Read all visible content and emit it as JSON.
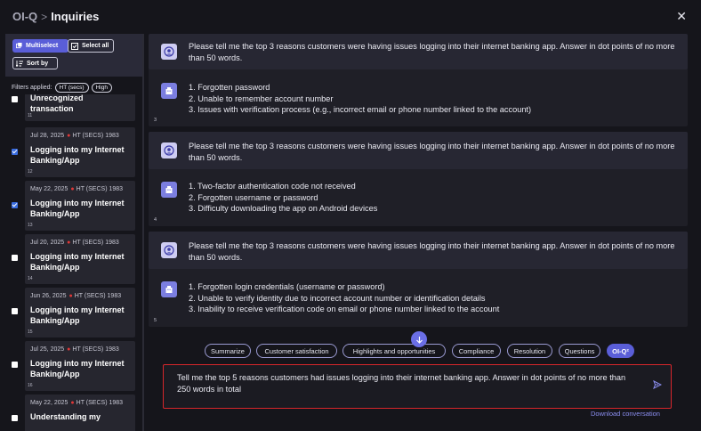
{
  "header": {
    "root": "OI-Q",
    "separator": ">",
    "current": "Inquiries",
    "close_glyph": "✕"
  },
  "left_toolbar": {
    "multiselect_label": "Multiselect",
    "select_all_label": "Select all",
    "sort_by_label": "Sort by",
    "filters_label": "Filters applied:",
    "filter_chips": [
      "HT (secs)",
      "High"
    ]
  },
  "inquiries": [
    {
      "date": "",
      "badge": "",
      "title": "Unrecognized transaction",
      "number": "11",
      "checked": false
    },
    {
      "date": "Jul 28, 2025",
      "badge": "HT (SECS) 1983",
      "title": "Logging into my Internet Banking/App",
      "number": "12",
      "checked": true
    },
    {
      "date": "May 22, 2025",
      "badge": "HT (SECS) 1983",
      "title": "Logging into my Internet Banking/App",
      "number": "13",
      "checked": true
    },
    {
      "date": "Jul 20, 2025",
      "badge": "HT (SECS) 1983",
      "title": "Logging into my Internet Banking/App",
      "number": "14",
      "checked": false
    },
    {
      "date": "Jun 26, 2025",
      "badge": "HT (SECS) 1983",
      "title": "Logging into my Internet Banking/App",
      "number": "15",
      "checked": false
    },
    {
      "date": "Jul 25, 2025",
      "badge": "HT (SECS) 1983",
      "title": "Logging into my Internet Banking/App",
      "number": "16",
      "checked": false
    },
    {
      "date": "May 22, 2025",
      "badge": "HT (SECS) 1983",
      "title": "Understanding my",
      "number": "",
      "checked": false
    }
  ],
  "conversation": [
    {
      "question": "Please tell me the top 3 reasons customers were having issues logging into their internet banking app. Answer in dot points of no more than 50 words.",
      "answer": [
        "1. Forgotten password",
        "2. Unable to remember account number",
        "3. Issues with verification process (e.g., incorrect email or phone number linked to the account)"
      ],
      "number": "3"
    },
    {
      "question": "Please tell me the top 3 reasons customers were having issues logging into their internet banking app. Answer in dot points of no more than 50 words.",
      "answer": [
        "1. Two-factor authentication code not received",
        "2. Forgotten username or password",
        "3. Difficulty downloading the app on Android devices"
      ],
      "number": "4"
    },
    {
      "question": "Please tell me the top 3 reasons customers were having issues logging into their internet banking app. Answer in dot points of no more than 50 words.",
      "answer": [
        "1. Forgotten login credentials (username or password)",
        "2. Unable to verify identity due to incorrect account number or identification details",
        "3. Inability to receive verification code on email or phone number linked to the account"
      ],
      "number": "5"
    }
  ],
  "action_chips": [
    "Summarize",
    "Customer satisfaction",
    "Highlights and opportunities",
    "Compliance",
    "Resolution",
    "Questions",
    "OI-Q²"
  ],
  "active_chip": "OI-Q²",
  "input": {
    "value": "Tell me the top 5 reasons customers had issues logging into their internet banking app. Answer in dot points of no more than 250 words in total"
  },
  "download_label": "Download conversation",
  "icons": {
    "close": "close-icon",
    "multiselect": "multiselect-icon",
    "select_all": "select-all-icon",
    "sort": "sort-icon",
    "user_avatar": "user-avatar-icon",
    "bot_avatar": "bot-avatar-icon",
    "scroll_down": "arrow-down-icon",
    "send": "send-icon"
  },
  "colors": {
    "accent": "#5a5ed8",
    "badge_dot": "#e03838",
    "input_border": "#d6262b",
    "link": "#8b8ef0"
  }
}
